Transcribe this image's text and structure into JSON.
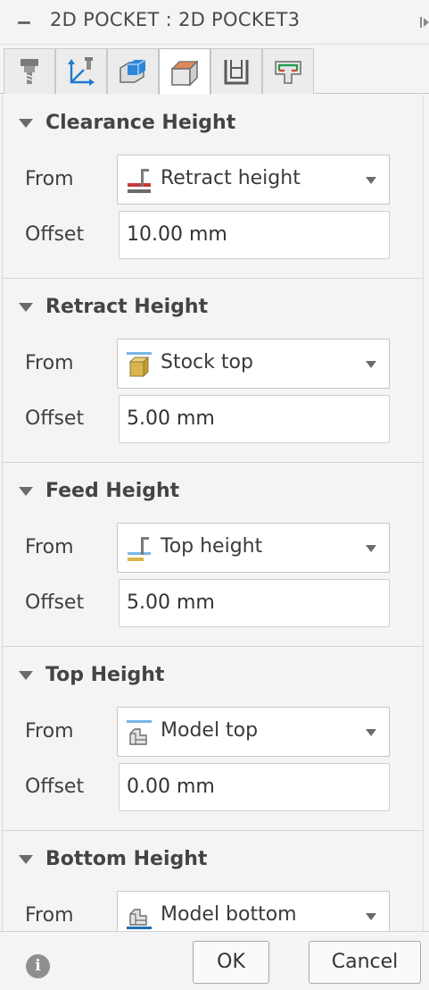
{
  "dialog": {
    "title": "2D POCKET : 2D POCKET3"
  },
  "tabs": [
    {
      "icon": "tool-icon"
    },
    {
      "icon": "geometry-axis-icon"
    },
    {
      "icon": "geometry-icon"
    },
    {
      "icon": "heights-icon",
      "active": true
    },
    {
      "icon": "passes-icon"
    },
    {
      "icon": "linking-icon"
    }
  ],
  "sections": [
    {
      "heading": "Clearance Height",
      "from_label": "From",
      "from_value": "Retract height",
      "from_icon": "retract-height-icon",
      "offset_label": "Offset",
      "offset_value": "10.00 mm"
    },
    {
      "heading": "Retract Height",
      "from_label": "From",
      "from_value": "Stock top",
      "from_icon": "stock-top-icon",
      "offset_label": "Offset",
      "offset_value": "5.00 mm"
    },
    {
      "heading": "Feed Height",
      "from_label": "From",
      "from_value": "Top height",
      "from_icon": "top-height-icon",
      "offset_label": "Offset",
      "offset_value": "5.00 mm"
    },
    {
      "heading": "Top Height",
      "from_label": "From",
      "from_value": "Model top",
      "from_icon": "model-top-icon",
      "offset_label": "Offset",
      "offset_value": "0.00 mm"
    },
    {
      "heading": "Bottom Height",
      "from_label": "From",
      "from_value": "Model bottom",
      "from_icon": "model-bottom-icon"
    }
  ],
  "footer": {
    "ok_label": "OK",
    "cancel_label": "Cancel",
    "info_glyph": "i"
  }
}
